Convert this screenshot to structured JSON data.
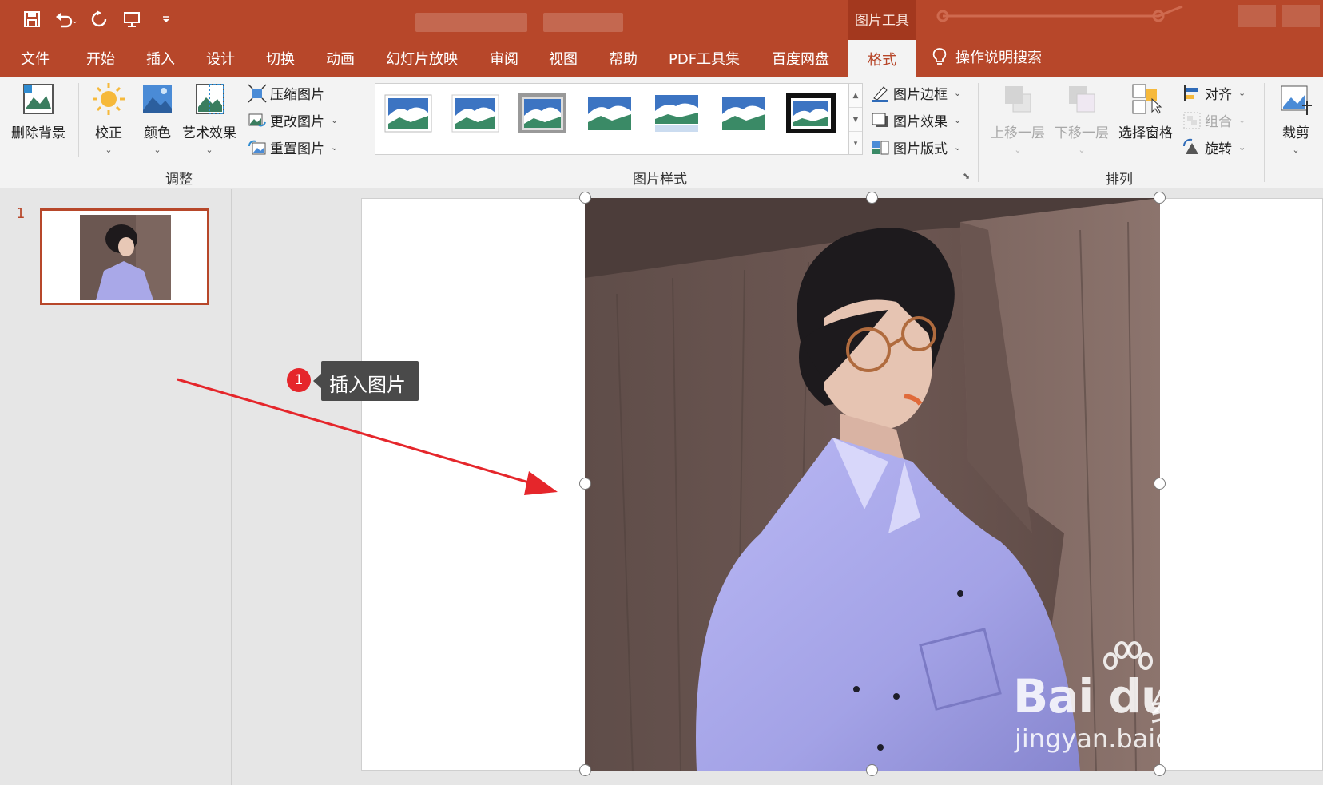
{
  "qat": {
    "save_icon": "save-icon",
    "undo_icon": "undo-icon",
    "redo_icon": "redo-icon",
    "present_icon": "present-from-start-icon",
    "customize_icon": "customize-qat-icon"
  },
  "contextual_tab": "图片工具",
  "tabs": [
    "文件",
    "开始",
    "插入",
    "设计",
    "切换",
    "动画",
    "幻灯片放映",
    "审阅",
    "视图",
    "帮助",
    "PDF工具集",
    "百度网盘"
  ],
  "active_tab": "格式",
  "tell_me": "操作说明搜索",
  "ribbon": {
    "adjust": {
      "remove_bg": "删除背景",
      "correct": "校正",
      "color": "颜色",
      "artistic": "艺术效果",
      "compress": "压缩图片",
      "change": "更改图片",
      "reset": "重置图片",
      "group_label": "调整"
    },
    "styles": {
      "border": "图片边框",
      "effects": "图片效果",
      "layout": "图片版式",
      "group_label": "图片样式"
    },
    "arrange": {
      "bring_forward": "上移一层",
      "send_backward": "下移一层",
      "selection_pane": "选择窗格",
      "align": "对齐",
      "group": "组合",
      "rotate": "旋转",
      "group_label": "排列"
    },
    "size": {
      "crop": "裁剪"
    }
  },
  "thumbnails": {
    "slide_number": "1"
  },
  "annotation": {
    "badge": "1",
    "text": "插入图片"
  },
  "watermark": {
    "brand": "Bai du",
    "cn": "经验",
    "url": "jingyan.baidu.com"
  },
  "colors": {
    "accent": "#b7472a",
    "ribbon_bg": "#f3f3f3",
    "arrow": "#e5262b"
  }
}
